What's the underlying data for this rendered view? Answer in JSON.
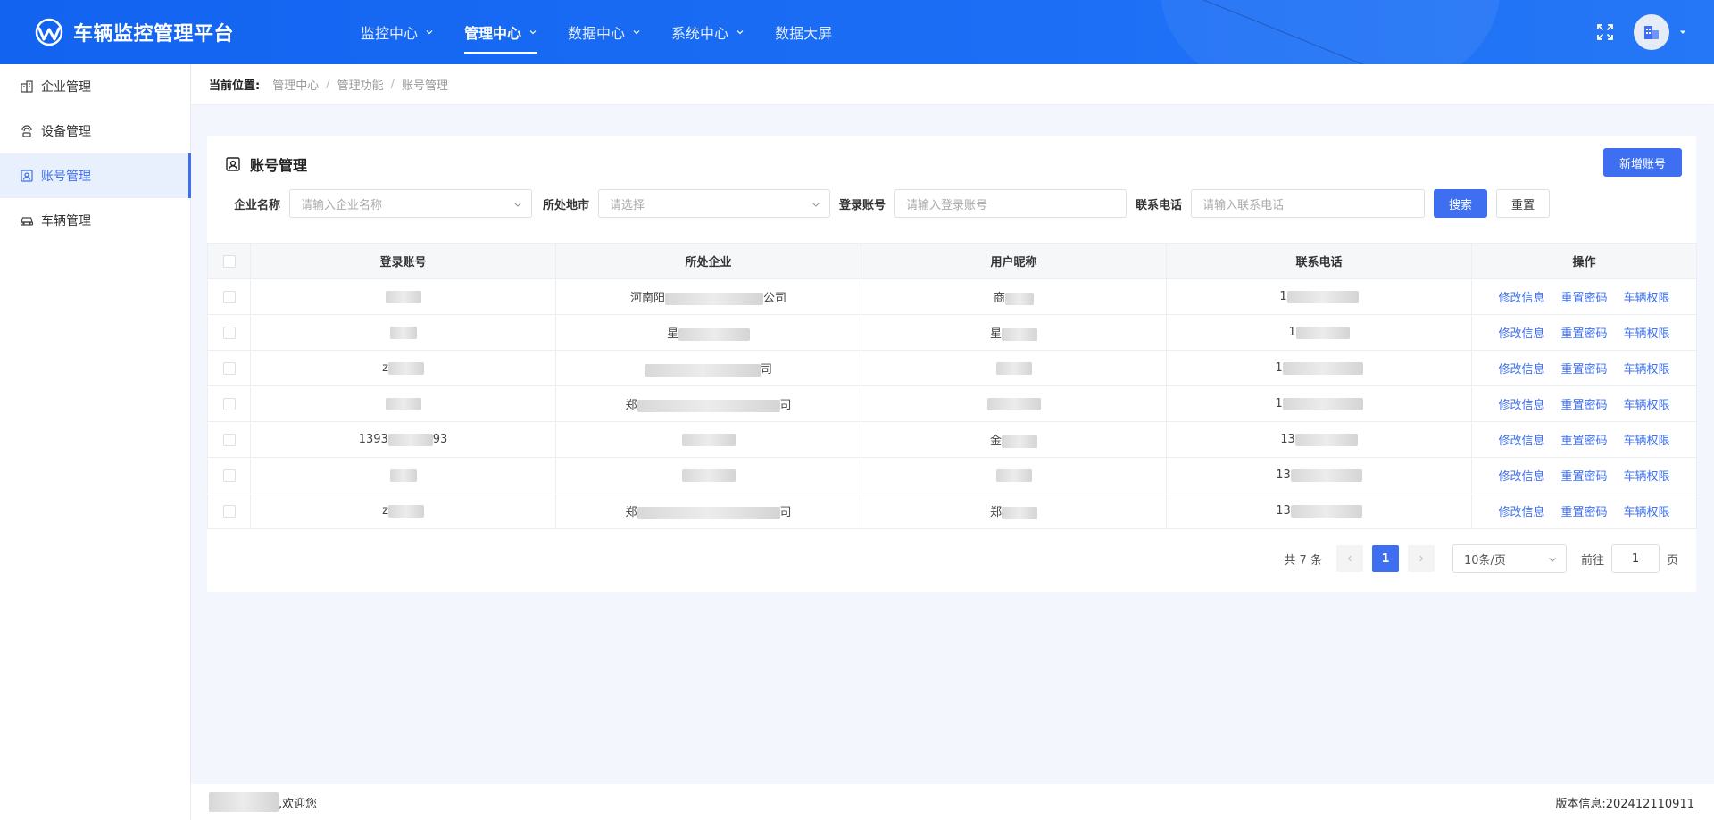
{
  "brand": {
    "title": "车辆监控管理平台",
    "logo_icon": "logo-icon"
  },
  "nav": [
    {
      "label": "监控中心",
      "dropdown": true,
      "active": false
    },
    {
      "label": "管理中心",
      "dropdown": true,
      "active": true
    },
    {
      "label": "数据中心",
      "dropdown": true,
      "active": false
    },
    {
      "label": "系统中心",
      "dropdown": true,
      "active": false
    },
    {
      "label": "数据大屏",
      "dropdown": false,
      "active": false
    }
  ],
  "sidebar": {
    "items": [
      {
        "label": "企业管理",
        "icon": "building-icon",
        "active": false
      },
      {
        "label": "设备管理",
        "icon": "device-icon",
        "active": false
      },
      {
        "label": "账号管理",
        "icon": "account-icon",
        "active": true
      },
      {
        "label": "车辆管理",
        "icon": "car-icon",
        "active": false
      }
    ]
  },
  "breadcrumb": {
    "label": "当前位置:",
    "items": [
      "管理中心",
      "管理功能",
      "账号管理"
    ],
    "separator": "/"
  },
  "card": {
    "title": "账号管理",
    "new_button": "新增账号"
  },
  "filters": {
    "company_label": "企业名称",
    "company_placeholder": "请输入企业名称",
    "region_label": "所处地市",
    "region_placeholder": "请选择",
    "account_label": "登录账号",
    "account_placeholder": "请输入登录账号",
    "phone_label": "联系电话",
    "phone_placeholder": "请输入联系电话",
    "search_button": "搜索",
    "reset_button": "重置"
  },
  "table": {
    "columns": [
      "登录账号",
      "所处企业",
      "用户昵称",
      "联系电话",
      "操作"
    ],
    "actions": [
      "修改信息",
      "重置密码",
      "车辆权限"
    ],
    "rows": [
      {
        "account": "",
        "company": "河南阳",
        "company_suffix": "公司",
        "nickname": "商",
        "phone": "1"
      },
      {
        "account": "",
        "company": "星",
        "company_suffix": "",
        "nickname": "星",
        "phone": "1"
      },
      {
        "account": "z",
        "company": "",
        "company_suffix": "司",
        "nickname": "",
        "phone": "1"
      },
      {
        "account": "",
        "company": "郑",
        "company_suffix": "司",
        "nickname": "",
        "phone": "1"
      },
      {
        "account": "1393",
        "account_suffix": "93",
        "company": "",
        "company_suffix": "",
        "nickname": "金",
        "phone": "13"
      },
      {
        "account": "",
        "company": "",
        "company_suffix": "",
        "nickname": "",
        "phone": "13"
      },
      {
        "account": "z",
        "company": "郑",
        "company_suffix": "司",
        "nickname": "郑",
        "phone": "13"
      }
    ]
  },
  "pagination": {
    "total": "共 7 条",
    "current_page": "1",
    "page_size": "10条/页",
    "goto_label": "前往",
    "goto_value": "1",
    "page_unit": "页"
  },
  "footer": {
    "welcome": ",欢迎您",
    "version": "版本信息:202412110911"
  },
  "colors": {
    "header_bg": "#1263f0",
    "primary": "#3d6ff0",
    "sidebar_active_bg": "#e8effd",
    "page_bg": "#f3f6fc"
  }
}
